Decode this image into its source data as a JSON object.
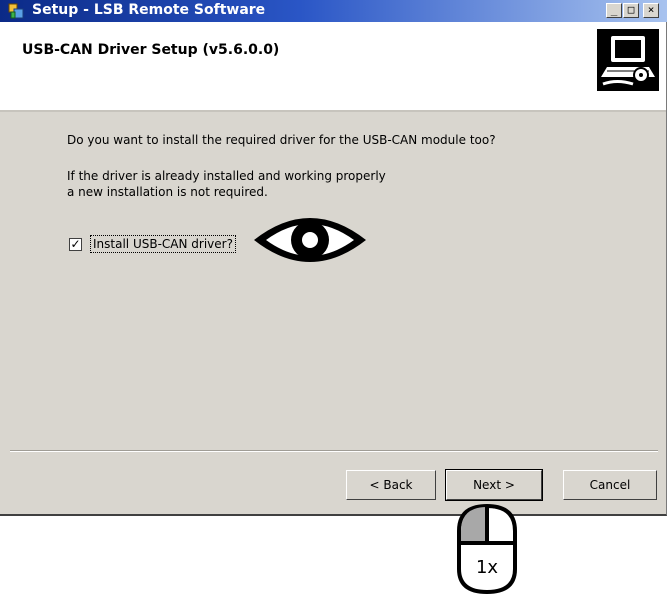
{
  "window": {
    "title": "Setup - LSB Remote Software",
    "controls": {
      "minimize": "_",
      "maximize": "□",
      "close": "×"
    }
  },
  "header": {
    "title": "USB-CAN Driver Setup (v5.6.0.0)",
    "icon": "computer-setup-icon"
  },
  "content": {
    "question": "Do you want to install the required driver for the USB-CAN module too?",
    "info_line1": "If the driver is already installed and working properly",
    "info_line2": "a new installation is not required.",
    "checkbox_label": "Install USB-CAN driver?",
    "checkbox_checked": true,
    "checkbox_mark": "✓"
  },
  "buttons": {
    "back": "< Back",
    "next": "Next >",
    "cancel": "Cancel"
  },
  "annotations": {
    "eye_icon": "eye-icon",
    "mouse_icon": "mouse-left-click-icon",
    "click_count": "1x"
  }
}
